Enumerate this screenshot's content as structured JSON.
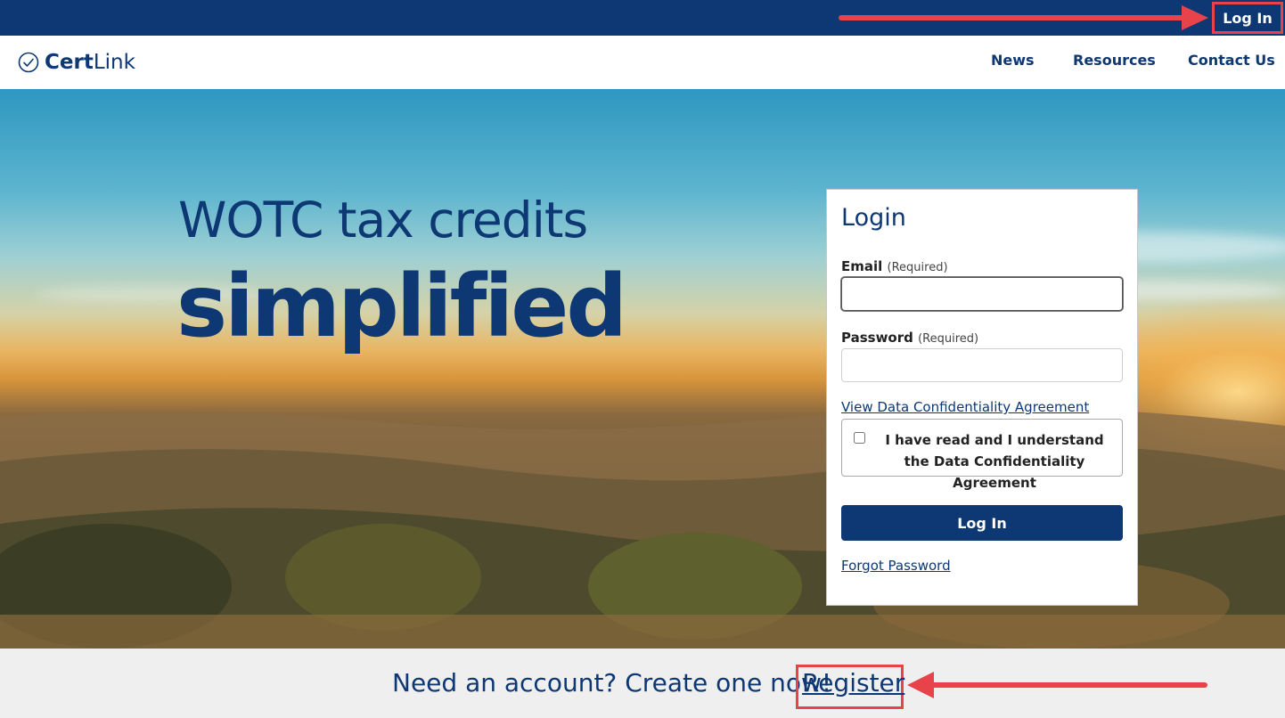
{
  "top_bar": {
    "login_label": "Log In"
  },
  "brand": {
    "name_bold": "Cert",
    "name_light": "Link"
  },
  "nav": {
    "items": [
      "News",
      "Resources",
      "Contact Us"
    ]
  },
  "hero": {
    "line1": "WOTC tax credits",
    "line2": "simplified"
  },
  "login_card": {
    "title": "Login",
    "email_label": "Email",
    "email_required": "(Required)",
    "email_value": "",
    "password_label": "Password",
    "password_required": "(Required)",
    "password_value": "",
    "agreement_link": "View Data Confidentiality Agreement",
    "agreement_checkbox": "I have read and I understand the Data Confidentiality Agreement",
    "agreement_checked": false,
    "submit_label": "Log In",
    "forgot_label": "Forgot Password"
  },
  "footer": {
    "prompt": "Need an account? Create one now!",
    "register_label": "Register"
  },
  "colors": {
    "brand_navy": "#0d3873",
    "highlight_red": "#e8434b",
    "footer_bg": "#efefef"
  },
  "icons": {
    "logo": "check-circle-icon",
    "annotation": "arrow-icon"
  }
}
